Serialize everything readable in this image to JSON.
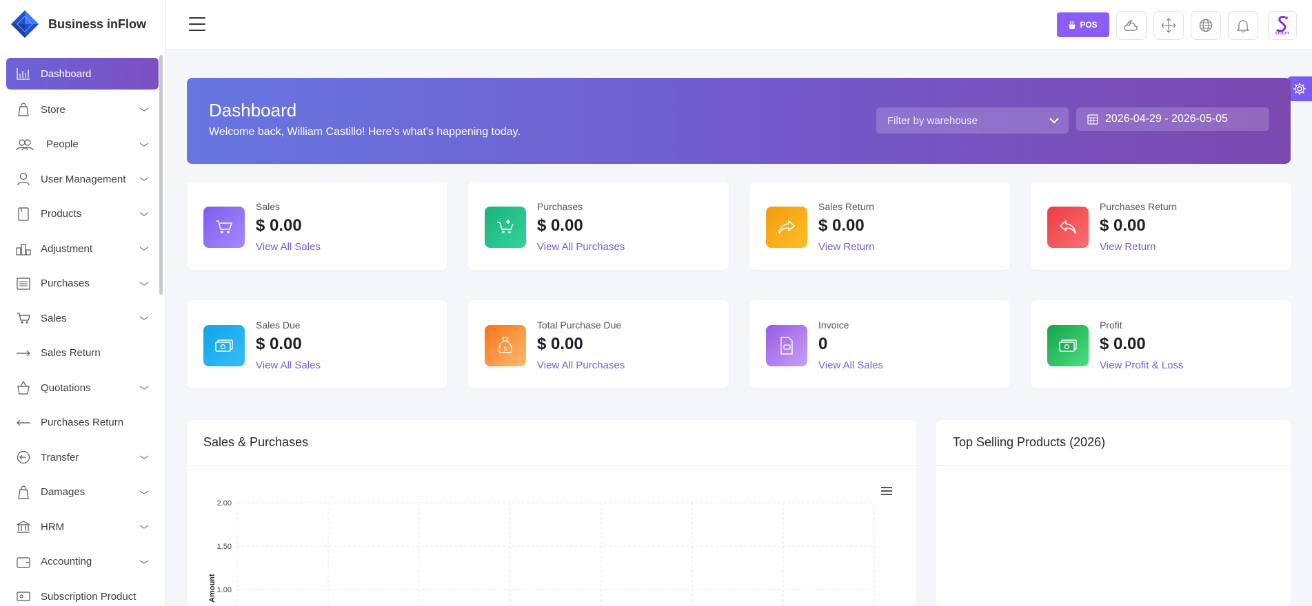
{
  "brand": {
    "name": "Business inFlow"
  },
  "sidebar": {
    "items": [
      {
        "label": "Dashboard",
        "icon": "chart-icon",
        "active": true,
        "expandable": false
      },
      {
        "label": "Store",
        "icon": "bag-icon",
        "expandable": true
      },
      {
        "label": "People",
        "icon": "people-icon",
        "expandable": true
      },
      {
        "label": "User Management",
        "icon": "user-icon",
        "expandable": true
      },
      {
        "label": "Products",
        "icon": "product-icon",
        "expandable": true
      },
      {
        "label": "Adjustment",
        "icon": "adjustment-icon",
        "expandable": true
      },
      {
        "label": "Purchases",
        "icon": "purchases-icon",
        "expandable": true
      },
      {
        "label": "Sales",
        "icon": "cart-icon",
        "expandable": true
      },
      {
        "label": "Sales Return",
        "icon": "arrow-right-icon",
        "expandable": false
      },
      {
        "label": "Quotations",
        "icon": "basket-icon",
        "expandable": true
      },
      {
        "label": "Purchases Return",
        "icon": "arrow-left-icon",
        "expandable": false
      },
      {
        "label": "Transfer",
        "icon": "transfer-icon",
        "expandable": true
      },
      {
        "label": "Damages",
        "icon": "damage-icon",
        "expandable": true
      },
      {
        "label": "HRM",
        "icon": "bank-icon",
        "expandable": true
      },
      {
        "label": "Accounting",
        "icon": "wallet-icon",
        "expandable": true
      },
      {
        "label": "Subscription Product",
        "icon": "subscription-icon",
        "expandable": false
      }
    ]
  },
  "topbar": {
    "pos_label": "POS",
    "avatar_text": "STOCKY"
  },
  "hero": {
    "title": "Dashboard",
    "subtitle": "Welcome back, William Castillo! Here's what's happening today.",
    "warehouse_placeholder": "Filter by warehouse",
    "date_range": "2026-04-29 - 2026-05-05"
  },
  "stats": [
    {
      "title": "Sales",
      "value": "$ 0.00",
      "link": "View All Sales",
      "color": "#8b5cf6",
      "icon": "cart-icon"
    },
    {
      "title": "Purchases",
      "value": "$ 0.00",
      "link": "View All Purchases",
      "color": "#22c08a",
      "icon": "cart-plus-icon"
    },
    {
      "title": "Sales Return",
      "value": "$ 0.00",
      "link": "View Return",
      "color": "#f5a413",
      "icon": "share-icon"
    },
    {
      "title": "Purchases Return",
      "value": "$ 0.00",
      "link": "View Return",
      "color": "#f0484f",
      "icon": "reply-icon"
    },
    {
      "title": "Sales Due",
      "value": "$ 0.00",
      "link": "View All Sales",
      "color": "#1aa7e8",
      "icon": "money-icon"
    },
    {
      "title": "Total Purchase Due",
      "value": "$ 0.00",
      "link": "View All Purchases",
      "color": "#f58a3c",
      "icon": "money-bag-icon"
    },
    {
      "title": "Invoice",
      "value": "0",
      "link": "View All Sales",
      "color": "#a56cf0",
      "icon": "invoice-icon"
    },
    {
      "title": "Profit",
      "value": "$ 0.00",
      "link": "View Profit & Loss",
      "color": "#21a556",
      "icon": "money-icon"
    }
  ],
  "panels": {
    "sales_purchases_title": "Sales & Purchases",
    "top_selling_title": "Top Selling Products (2026)"
  },
  "chart_data": {
    "type": "line",
    "title": "",
    "ylabel": "Amount",
    "yticks": [
      "2.00",
      "1.50",
      "1.00"
    ],
    "ylim": [
      0,
      2
    ],
    "grid": true,
    "series": []
  }
}
